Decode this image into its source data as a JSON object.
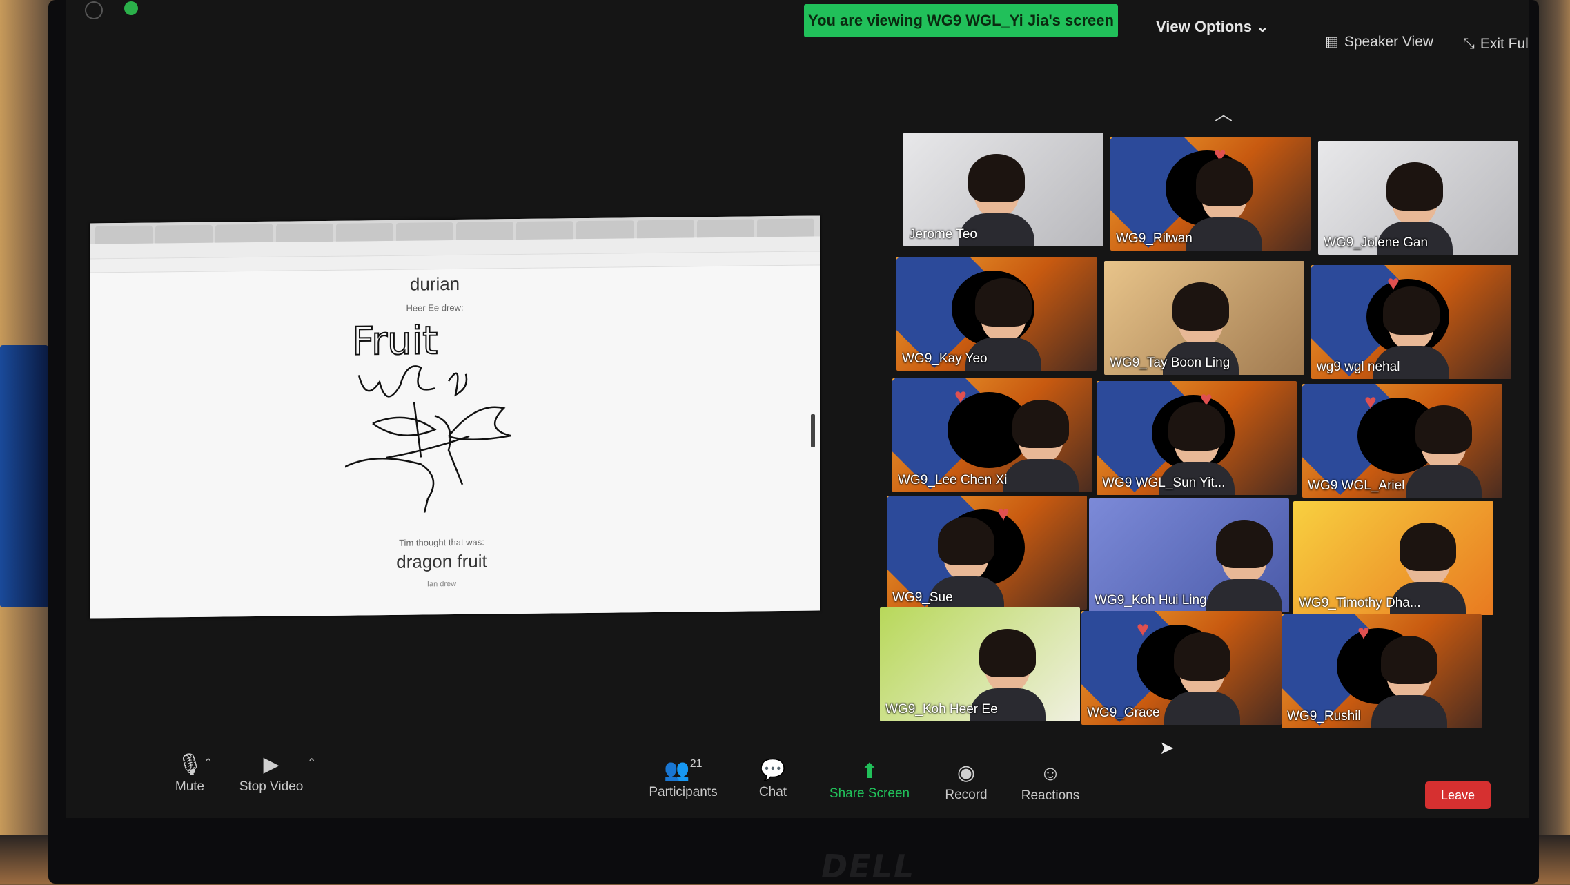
{
  "top_bar": {
    "viewing_banner": "You are viewing WG9 WGL_Yi Jia's screen",
    "view_options": "View Options ⌄",
    "speaker_view": "Speaker View",
    "exit_full_screen": "Exit Full Scree"
  },
  "shared_screen": {
    "word_1": "durian",
    "caption_1": "Heer Ee drew:",
    "drawing_text": "Fruit",
    "caption_2": "Tim thought that was:",
    "word_2": "dragon fruit",
    "caption_3": "Ian drew"
  },
  "gallery": {
    "participants": [
      "Jerome Teo",
      "WG9_Rilwan",
      "WG9_Jolene Gan",
      "WG9_Kay Yeo",
      "WG9_Tay Boon Ling",
      "wg9 wgl nehal",
      "WG9_Lee Chen Xi",
      "WG9 WGL_Sun Yit...",
      "WG9 WGL_Ariel",
      "WG9_Sue",
      "WG9_Koh Hui Ling",
      "WG9_Timothy Dha...",
      "WG9_Koh Heer Ee",
      "WG9_Grace",
      "WG9_Rushil"
    ]
  },
  "toolbar": {
    "mute": "Mute",
    "stop_video": "Stop Video",
    "participants": "Participants",
    "participant_count": "21",
    "chat": "Chat",
    "share_screen": "Share Screen",
    "record": "Record",
    "reactions": "Reactions",
    "leave": "Leave"
  },
  "device": {
    "brand": "DELL"
  },
  "colors": {
    "share_banner": "#21c05a",
    "leave_button": "#d63030",
    "screen_bg": "#151515"
  }
}
